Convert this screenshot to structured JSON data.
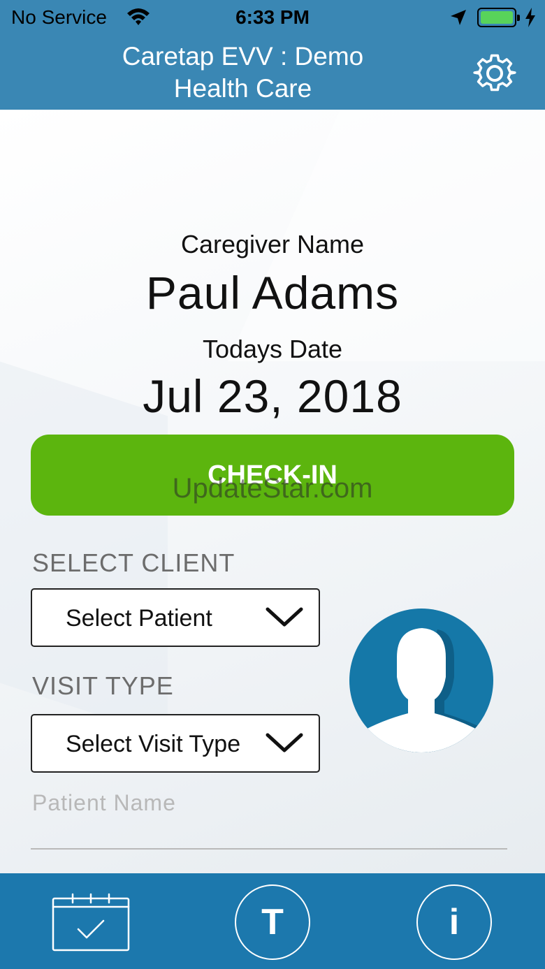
{
  "status_bar": {
    "carrier": "No Service",
    "time": "6:33 PM",
    "battery_color": "#58d35a"
  },
  "header": {
    "title": "Caretap EVV : Demo Health Care",
    "settings_icon": "gear-icon",
    "background": "#3a87b4"
  },
  "caregiver": {
    "label": "Caregiver Name",
    "name": "Paul Adams"
  },
  "date": {
    "label": "Todays Date",
    "value": "Jul 23, 2018"
  },
  "checkin_button": {
    "label": "CHECK-IN",
    "color": "#5cb50e"
  },
  "watermark": "UpdateStar.com",
  "select_client": {
    "label": "SELECT CLIENT",
    "value": "Select Patient"
  },
  "visit_type": {
    "label": "VISIT TYPE",
    "value": "Select Visit Type"
  },
  "patient_name": {
    "placeholder": "Patient Name"
  },
  "avatar": {
    "icon": "person-silhouette-icon",
    "color": "#1578a8"
  },
  "bottom_bar": {
    "background": "#1c78ad",
    "calendar_icon": "calendar-check-icon",
    "t_label": "T",
    "info_label": "i"
  }
}
